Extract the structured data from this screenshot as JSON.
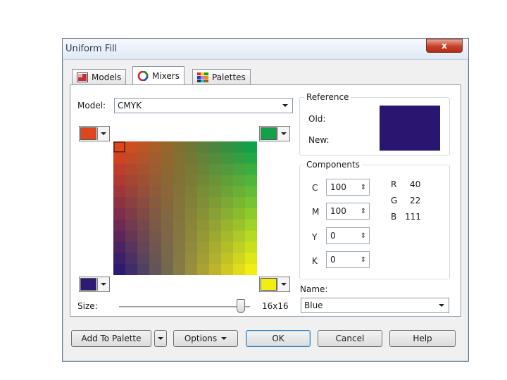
{
  "window": {
    "title": "Uniform Fill",
    "close_glyph": "x"
  },
  "tabs": [
    {
      "label": "Models",
      "icon": "models-icon",
      "active": false
    },
    {
      "label": "Mixers",
      "icon": "mixers-icon",
      "active": true
    },
    {
      "label": "Palettes",
      "icon": "palettes-icon",
      "active": false
    }
  ],
  "model": {
    "label": "Model:",
    "value": "CMYK"
  },
  "corners": {
    "top_left": "#e0461b",
    "top_right": "#12a04a",
    "bottom_left": "#2c1a73",
    "bottom_right": "#f3ee12"
  },
  "reference": {
    "legend": "Reference",
    "old_label": "Old:",
    "new_label": "New:",
    "color": "#2a1670"
  },
  "components": {
    "legend": "Components",
    "fields": [
      {
        "label": "C",
        "value": "100"
      },
      {
        "label": "M",
        "value": "100"
      },
      {
        "label": "Y",
        "value": "0"
      },
      {
        "label": "K",
        "value": "0"
      }
    ],
    "rgb": [
      {
        "label": "R",
        "value": "40"
      },
      {
        "label": "G",
        "value": "22"
      },
      {
        "label": "B",
        "value": "111"
      }
    ]
  },
  "name": {
    "label": "Name:",
    "value": "Blue"
  },
  "size": {
    "label": "Size:",
    "value": "16x16",
    "slider_fraction": 0.93
  },
  "buttons": {
    "add_to_palette": "Add To Palette",
    "options": "Options",
    "ok": "OK",
    "cancel": "Cancel",
    "help": "Help"
  }
}
